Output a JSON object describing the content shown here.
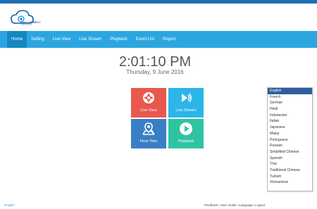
{
  "app": {
    "logo_text": "EyeCONNECT",
    "logo_sub": "WEB PORTAL"
  },
  "nav": {
    "items": [
      {
        "label": "Home",
        "active": true
      },
      {
        "label": "Setting",
        "active": false
      },
      {
        "label": "Live View",
        "active": false
      },
      {
        "label": "Live Stream",
        "active": false
      },
      {
        "label": "Playback",
        "active": false
      },
      {
        "label": "Event List",
        "active": false
      },
      {
        "label": "Report",
        "active": false
      }
    ]
  },
  "clock": {
    "time": "2:01:10 PM",
    "date": "Thursday, 9 June 2016"
  },
  "tiles": [
    {
      "label": "Live View",
      "icon": "camera-aperture-icon",
      "color": "#e8584e"
    },
    {
      "label": "Live Stream",
      "icon": "broadcast-icon",
      "color": "#2cb5e8"
    },
    {
      "label": "Floor Plan",
      "icon": "map-pin-icon",
      "color": "#3a7fc6"
    },
    {
      "label": "Playback",
      "icon": "play-icon",
      "color": "#2ec4a2"
    }
  ],
  "language": {
    "selected": "English",
    "options": [
      "English",
      "French",
      "German",
      "Hindi",
      "Indonesian",
      "Italian",
      "Japanese",
      "Malay",
      "Portuguese",
      "Russian",
      "Simplified Chinese",
      "Spanish",
      "Thai",
      "Traditional Chinese",
      "Turkish",
      "Vietnamese"
    ]
  },
  "footer": {
    "left": "English",
    "links": [
      "Feedback",
      "User Guide",
      "Language",
      "Logout"
    ]
  },
  "colors": {
    "top_strip": "#1f6fb2",
    "navbar": "#2ca6e0",
    "nav_active": "#1588c3",
    "dropdown_selected": "#2f5e9e"
  }
}
